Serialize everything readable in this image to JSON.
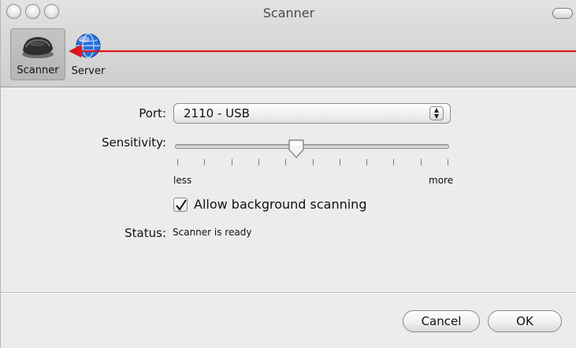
{
  "window": {
    "title": "Scanner"
  },
  "toolbar": {
    "items": [
      {
        "label": "Scanner",
        "icon": "scanner-icon",
        "selected": true
      },
      {
        "label": "Server",
        "icon": "globe-icon",
        "selected": false
      }
    ]
  },
  "form": {
    "port_label": "Port:",
    "port_value": "2110 - USB",
    "sensitivity_label": "Sensitivity:",
    "sensitivity_level": 0.44,
    "slider_min_label": "less",
    "slider_max_label": "more",
    "background_scanning_label": "Allow background scanning",
    "background_scanning_checked": true,
    "status_label": "Status:",
    "status_value": "Scanner is ready"
  },
  "buttons": {
    "cancel": "Cancel",
    "ok": "OK"
  },
  "colors": {
    "arrow": "#e0161a",
    "globe": "#2a6fd6"
  }
}
